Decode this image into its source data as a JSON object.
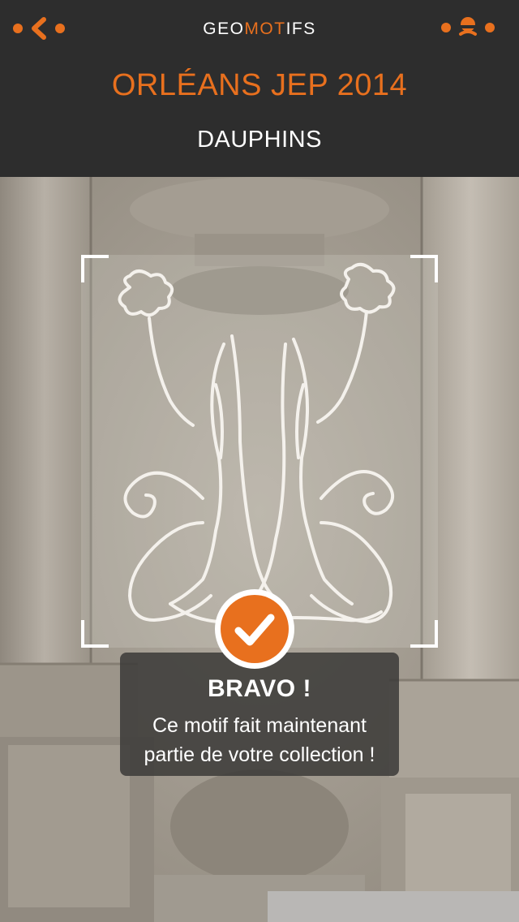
{
  "app": {
    "logo_prefix": "GEO",
    "logo_accent": "MOT",
    "logo_suffix": "IFS"
  },
  "header": {
    "event_title": "ORLÉANS JEP 2014",
    "motif_name": "DAUPHINS"
  },
  "icons": {
    "back": "chevron-left-icon",
    "menu": "orange-menu-icon",
    "check": "checkmark-icon"
  },
  "success": {
    "title": "BRAVO !",
    "message_line1": "Ce motif fait maintenant",
    "message_line2": "partie de votre collection !"
  },
  "colors": {
    "accent": "#e8701e",
    "header_bg": "#2d2d2d",
    "text_light": "#ffffff"
  }
}
